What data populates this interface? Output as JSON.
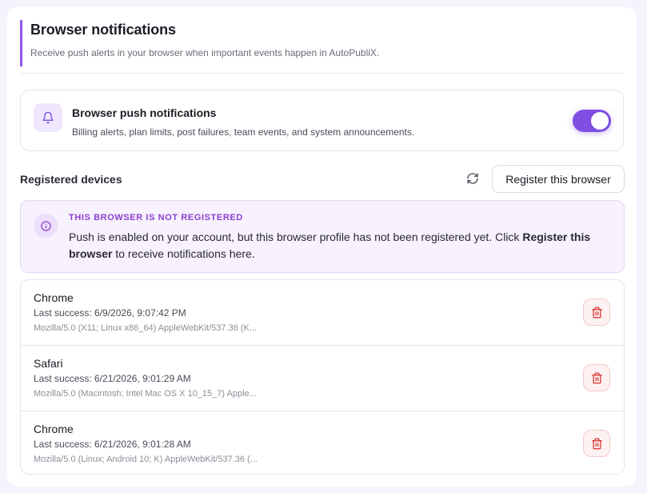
{
  "section": {
    "title": "Browser notifications",
    "subtitle": "Receive push alerts in your browser when important events happen in AutoPubliX."
  },
  "push": {
    "icon": "bell-icon",
    "title": "Browser push notifications",
    "description": "Billing alerts, plan limits, post failures, team events, and system announcements.",
    "enabled": true
  },
  "devices": {
    "title": "Registered devices",
    "refresh_icon": "refresh-icon",
    "register_label": "Register this browser"
  },
  "notice": {
    "icon": "info-icon",
    "title": "THIS BROWSER IS NOT REGISTERED",
    "body_prefix": "Push is enabled on your account, but this browser profile has not been registered yet. Click ",
    "body_strong": "Register this browser",
    "body_suffix": " to receive notifications here."
  },
  "device_list": [
    {
      "name": "Chrome",
      "last_success": "Last success: 6/9/2026, 9:07:42 PM",
      "user_agent": "Mozilla/5.0 (X11; Linux x86_64) AppleWebKit/537.36 (K..."
    },
    {
      "name": "Safari",
      "last_success": "Last success: 6/21/2026, 9:01:29 AM",
      "user_agent": "Mozilla/5.0 (Macintosh; Intel Mac OS X 10_15_7) Apple..."
    },
    {
      "name": "Chrome",
      "last_success": "Last success: 6/21/2026, 9:01:28 AM",
      "user_agent": "Mozilla/5.0 (Linux; Android 10; K) AppleWebKit/537.36 (..."
    }
  ],
  "colors": {
    "accent": "#7f4ee3",
    "notice_title": "#8b3fd0",
    "danger": "#d92d2d"
  }
}
